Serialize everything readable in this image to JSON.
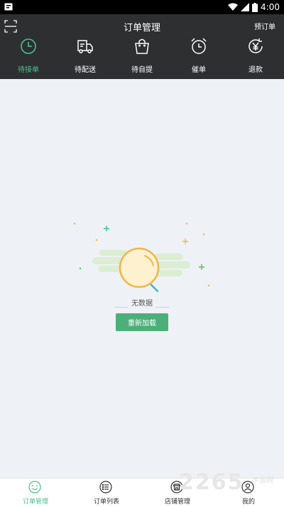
{
  "status_bar": {
    "time": "4:00"
  },
  "header": {
    "title": "订单管理",
    "preorder_label": "预订单",
    "tabs": [
      {
        "label": "待接单",
        "icon": "clock-icon",
        "active": true
      },
      {
        "label": "待配送",
        "icon": "delivery-truck-icon",
        "active": false
      },
      {
        "label": "待自提",
        "icon": "shopping-bag-icon",
        "active": false
      },
      {
        "label": "催单",
        "icon": "alarm-clock-icon",
        "active": false
      },
      {
        "label": "退款",
        "icon": "yen-refund-icon",
        "active": false
      }
    ]
  },
  "empty_state": {
    "message": "无数据",
    "reload_label": "重新加载"
  },
  "bottom_nav": [
    {
      "label": "订单管理",
      "icon": "order-manage-icon",
      "active": true
    },
    {
      "label": "订单列表",
      "icon": "order-list-icon",
      "active": false
    },
    {
      "label": "店铺管理",
      "icon": "store-icon",
      "active": false
    },
    {
      "label": "我的",
      "icon": "user-icon",
      "active": false
    }
  ],
  "watermark": {
    "number": "2265",
    "site": "手游网"
  },
  "colors": {
    "accent": "#4cc08a",
    "header_bg": "#2d2f31",
    "button_bg": "#4caf7a",
    "page_bg": "#eef1f5"
  }
}
